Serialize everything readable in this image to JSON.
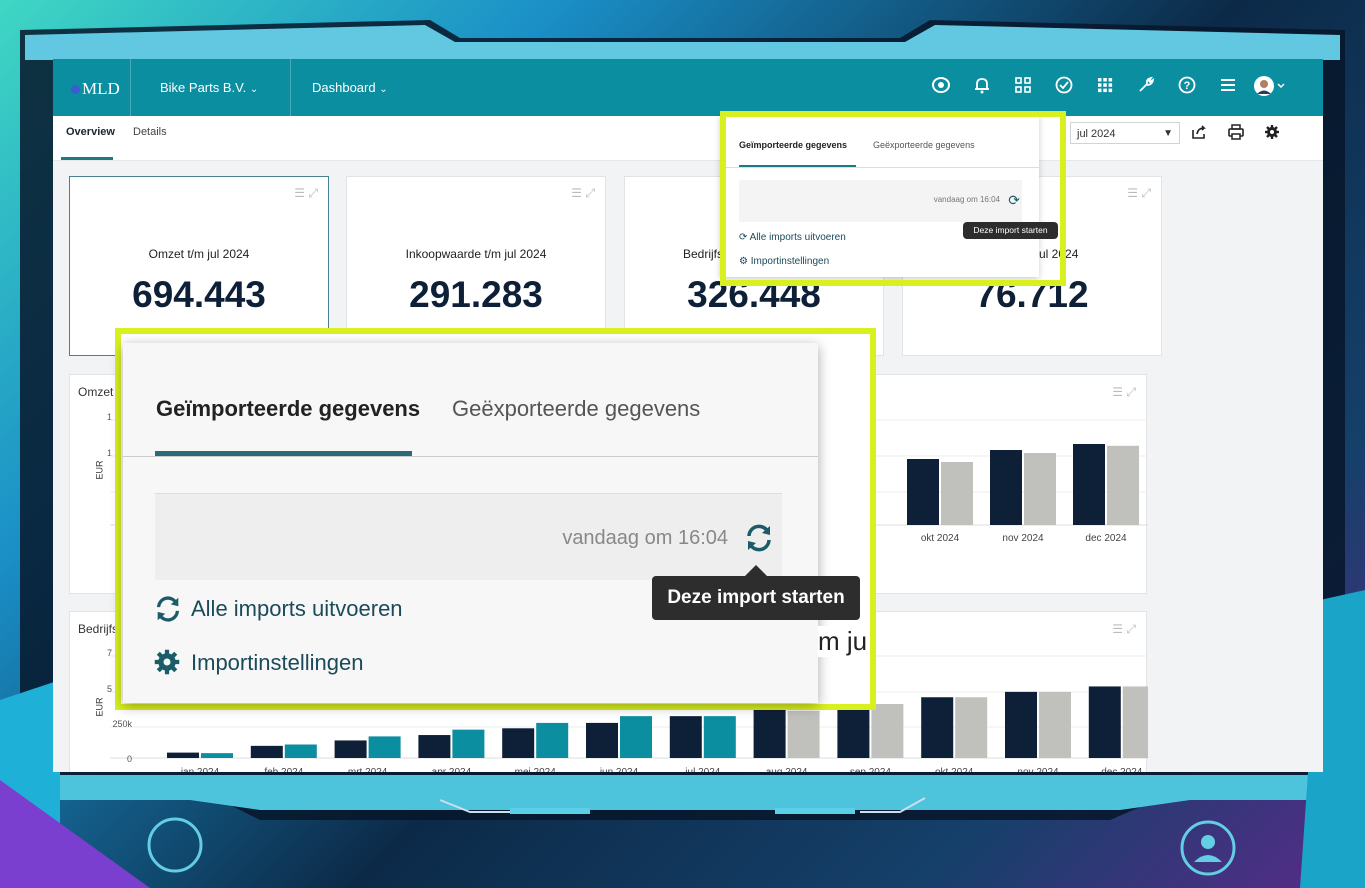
{
  "app": {
    "logo": "MLD",
    "company": "Bike Parts B.V.",
    "section": "Dashboard",
    "chevron": "⌄",
    "icons": [
      "eye-icon",
      "bell-icon",
      "org-icon",
      "check-circle-icon",
      "apps-grid-icon",
      "wrench-icon",
      "help-icon",
      "hamburger-icon",
      "avatar"
    ]
  },
  "tabs": {
    "overview": "Overview",
    "details": "Details"
  },
  "period": {
    "selected": "jul 2024"
  },
  "kpis": [
    {
      "title": "Omzet t/m jul 2024",
      "value": "694.443"
    },
    {
      "title": "Inkoopwaarde t/m jul 2024",
      "value": "291.283"
    },
    {
      "title": "Bedrijfs",
      "value": "326.448"
    },
    {
      "title": "m jul 2024",
      "value": "76.712"
    }
  ],
  "panel1": {
    "title": "Omzet",
    "ylabel": "EUR",
    "ticks": [
      "1",
      "1"
    ]
  },
  "panel2": {
    "title": "Bedrijfs",
    "partial_title": "m jul",
    "ylabel": "EUR",
    "ticks": [
      "7",
      "5",
      "250k",
      "0"
    ]
  },
  "popup": {
    "tab_imported": "Geïmporteerde gegevens",
    "tab_exported": "Geëxporteerde gegevens",
    "timestamp": "vandaag om 16:04",
    "run_all": "Alle imports uitvoeren",
    "settings": "Importinstellingen",
    "tooltip": "Deze import starten"
  },
  "colors": {
    "teal": "#0b8ea0",
    "navy": "#0e2038",
    "grey": "#c0c0bc",
    "highlight": "#d9f020"
  },
  "chart_data": [
    {
      "type": "bar",
      "title": "Omzet",
      "ylabel": "EUR",
      "categories": [
        "okt 2024",
        "nov 2024",
        "dec 2024"
      ],
      "series": [
        {
          "values": [
            110,
            125,
            135
          ]
        },
        {
          "values": [
            105,
            120,
            132
          ]
        }
      ]
    },
    {
      "type": "bar",
      "title": "Bedrijfs",
      "ylabel": "EUR",
      "categories": [
        "jan 2024",
        "feb 2024",
        "mrt 2024",
        "apr 2024",
        "mei 2024",
        "jun 2024",
        "jul 2024",
        "aug 2024",
        "sep 2024",
        "okt 2024",
        "nov 2024",
        "dec 2024"
      ],
      "series": [
        {
          "values": [
            20,
            45,
            65,
            85,
            110,
            130,
            155,
            180,
            200,
            225,
            245,
            265
          ]
        },
        {
          "values": [
            18,
            50,
            80,
            105,
            130,
            155,
            155,
            0,
            0,
            0,
            0,
            0
          ]
        },
        {
          "values": [
            0,
            0,
            0,
            0,
            0,
            0,
            0,
            175,
            200,
            225,
            245,
            265
          ]
        }
      ],
      "ylim": [
        0,
        350
      ]
    }
  ]
}
